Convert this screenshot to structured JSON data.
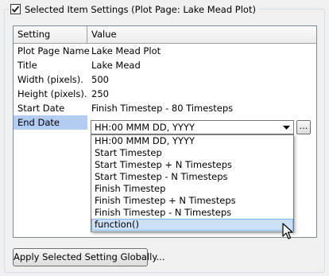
{
  "group": {
    "checked": true,
    "title": "Selected Item Settings (Plot Page: Lake Mead Plot)"
  },
  "grid": {
    "headers": [
      "Setting",
      "Value"
    ],
    "rows": [
      {
        "setting": "Plot Page Name",
        "value": "Lake Mead Plot"
      },
      {
        "setting": "Title",
        "value": "Lake Mead"
      },
      {
        "setting": "Width (pixels).",
        "value": "500"
      },
      {
        "setting": "Height (pixels).",
        "value": "250"
      },
      {
        "setting": "Start Date",
        "value": "Finish Timestep - 80 Timesteps"
      },
      {
        "setting": "End Date",
        "value": ""
      }
    ]
  },
  "combo": {
    "selected": "HH:00 MMM DD, YYYY",
    "ellipsis": "...",
    "options": [
      "HH:00 MMM DD, YYYY",
      "Start Timestep",
      "Start Timestep + N Timesteps",
      "Start Timestep - N Timesteps",
      "Finish Timestep",
      "Finish Timestep + N Timesteps",
      "Finish Timestep - N Timesteps",
      "function()"
    ],
    "highlighted_option": "function()"
  },
  "buttons": {
    "apply": "Apply Selected Setting Globally..."
  },
  "colors": {
    "selection": "#b3cdf2",
    "hover": "#cce0f7"
  }
}
